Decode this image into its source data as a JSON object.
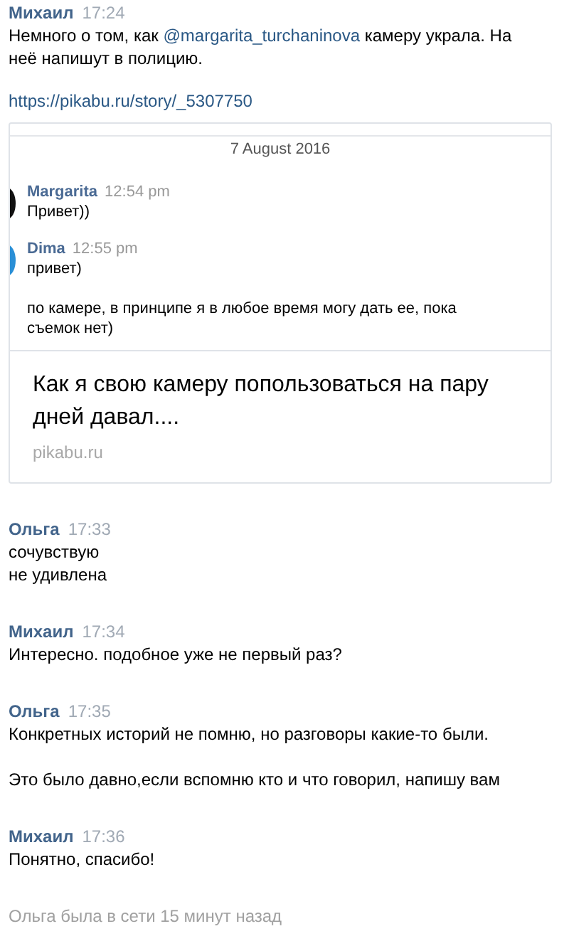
{
  "messages": [
    {
      "author": "Михаил",
      "time": "17:24",
      "segments": [
        {
          "kind": "text",
          "text": "Немного о том, как "
        },
        {
          "kind": "mention",
          "text": "@margarita_turchaninova"
        },
        {
          "kind": "text",
          "text": " камеру украла. На неё напишут в полицию."
        }
      ],
      "link": "https://pikabu.ru/story/_5307750",
      "attachment": {
        "date": "7 August 2016",
        "chat": [
          {
            "author": "Margarita",
            "time": "12:54 pm",
            "color": "#111111",
            "lines": [
              "Привет))"
            ]
          },
          {
            "author": "Dima",
            "time": "12:55 pm",
            "color": "#2a8fd6",
            "lines": [
              "привет)",
              "по камере, в принципе я в любое время могу дать ее, пока съемок нет)"
            ]
          }
        ],
        "title": "Как я свою камеру попользоваться на пару дней давал....",
        "domain": "pikabu.ru"
      }
    },
    {
      "author": "Ольга",
      "time": "17:33",
      "paragraphs": [
        [
          "сочувствую",
          "не удивлена"
        ]
      ]
    },
    {
      "author": "Михаил",
      "time": "17:34",
      "paragraphs": [
        [
          "Интересно. подобное уже не первый раз?"
        ]
      ]
    },
    {
      "author": "Ольга",
      "time": "17:35",
      "paragraphs": [
        [
          "Конкретных историй не помню, но разговоры какие-то были."
        ],
        [
          "Это было давно,если вспомню кто и что говорил, напишу вам"
        ]
      ]
    },
    {
      "author": "Михаил",
      "time": "17:36",
      "paragraphs": [
        [
          "Понятно, спасибо!"
        ]
      ]
    }
  ],
  "status": "Ольга была в сети 15 минут назад"
}
